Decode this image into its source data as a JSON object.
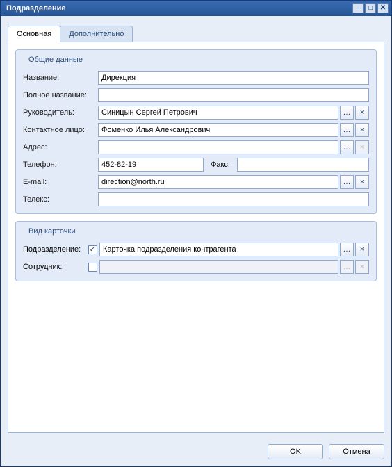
{
  "window": {
    "title": "Подразделение"
  },
  "tabs": {
    "main": "Основная",
    "additional": "Дополнительно"
  },
  "common": {
    "legend": "Общие данные",
    "labels": {
      "name": "Название:",
      "full_name": "Полное название:",
      "manager": "Руководитель:",
      "contact": "Контактное лицо:",
      "address": "Адрес:",
      "phone": "Телефон:",
      "fax": "Факс:",
      "email": "E-mail:",
      "telex": "Телекс:"
    },
    "values": {
      "name": "Дирекция",
      "full_name": "",
      "manager": "Синицын Сергей Петрович",
      "contact": "Фоменко Илья Александрович",
      "address": "",
      "phone": "452-82-19",
      "fax": "",
      "email": "direction@north.ru",
      "telex": ""
    }
  },
  "card": {
    "legend": "Вид карточки",
    "labels": {
      "department": "Подразделение:",
      "employee": "Сотрудник:"
    },
    "values": {
      "department": "Карточка подразделения контрагента",
      "employee": ""
    },
    "checks": {
      "department": "✓",
      "employee": ""
    }
  },
  "buttons": {
    "ok": "OK",
    "cancel": "Отмена",
    "browse": "…",
    "clear": "×"
  }
}
